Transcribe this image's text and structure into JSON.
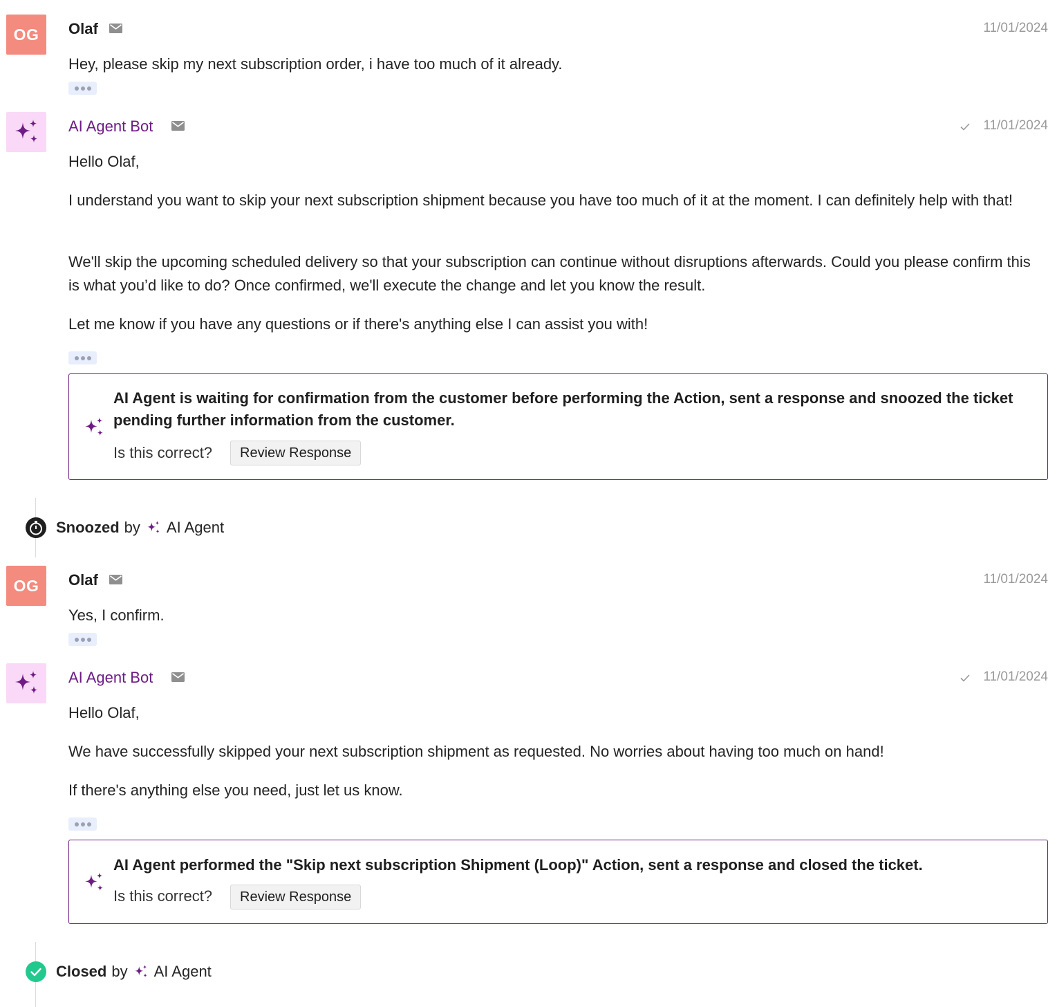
{
  "colors": {
    "bot_accent": "#6e1b84",
    "user_avatar_bg": "#f38b7e",
    "bot_avatar_bg": "#f9d9f7",
    "closed_green": "#22c98e"
  },
  "messages": [
    {
      "avatar_initials": "OG",
      "author": "Olaf",
      "date": "11/01/2024",
      "paragraphs": [
        "Hey, please skip my next subscription order, i have too much of it already."
      ]
    },
    {
      "author": "AI Agent Bot",
      "date": "11/01/2024",
      "paragraphs": [
        "Hello Olaf,",
        "I understand you want to skip your next subscription shipment because you have too much of it at the moment. I can definitely help with that!",
        "We'll skip the upcoming scheduled delivery so that your subscription can continue without disruptions afterwards. Could you please confirm this is what you’d like to do? Once confirmed, we'll execute the change and let you know the result.",
        "Let me know if you have any questions or if there's anything else I can assist you with!"
      ],
      "ai_box": {
        "message": "AI Agent is waiting for confirmation from the customer before performing the Action, sent a response and snoozed the ticket pending further information from the customer.",
        "question": "Is this correct?",
        "button": "Review Response"
      }
    },
    {
      "avatar_initials": "OG",
      "author": "Olaf",
      "date": "11/01/2024",
      "paragraphs": [
        "Yes, I confirm."
      ]
    },
    {
      "author": "AI Agent Bot",
      "date": "11/01/2024",
      "paragraphs": [
        "Hello Olaf,",
        "We have successfully skipped your next subscription shipment as requested. No worries about having too much on hand!",
        "If there's anything else you need, just let us know."
      ],
      "ai_box": {
        "message": "AI Agent performed the \"Skip next subscription Shipment (Loop)\" Action, sent a response and closed the ticket.",
        "question": "Is this correct?",
        "button": "Review Response"
      }
    }
  ],
  "events": [
    {
      "status": "Snoozed",
      "by": "by",
      "actor": "AI Agent",
      "icon": "timer-icon"
    },
    {
      "status": "Closed",
      "by": "by",
      "actor": "AI Agent",
      "icon": "check-circle-icon"
    }
  ]
}
